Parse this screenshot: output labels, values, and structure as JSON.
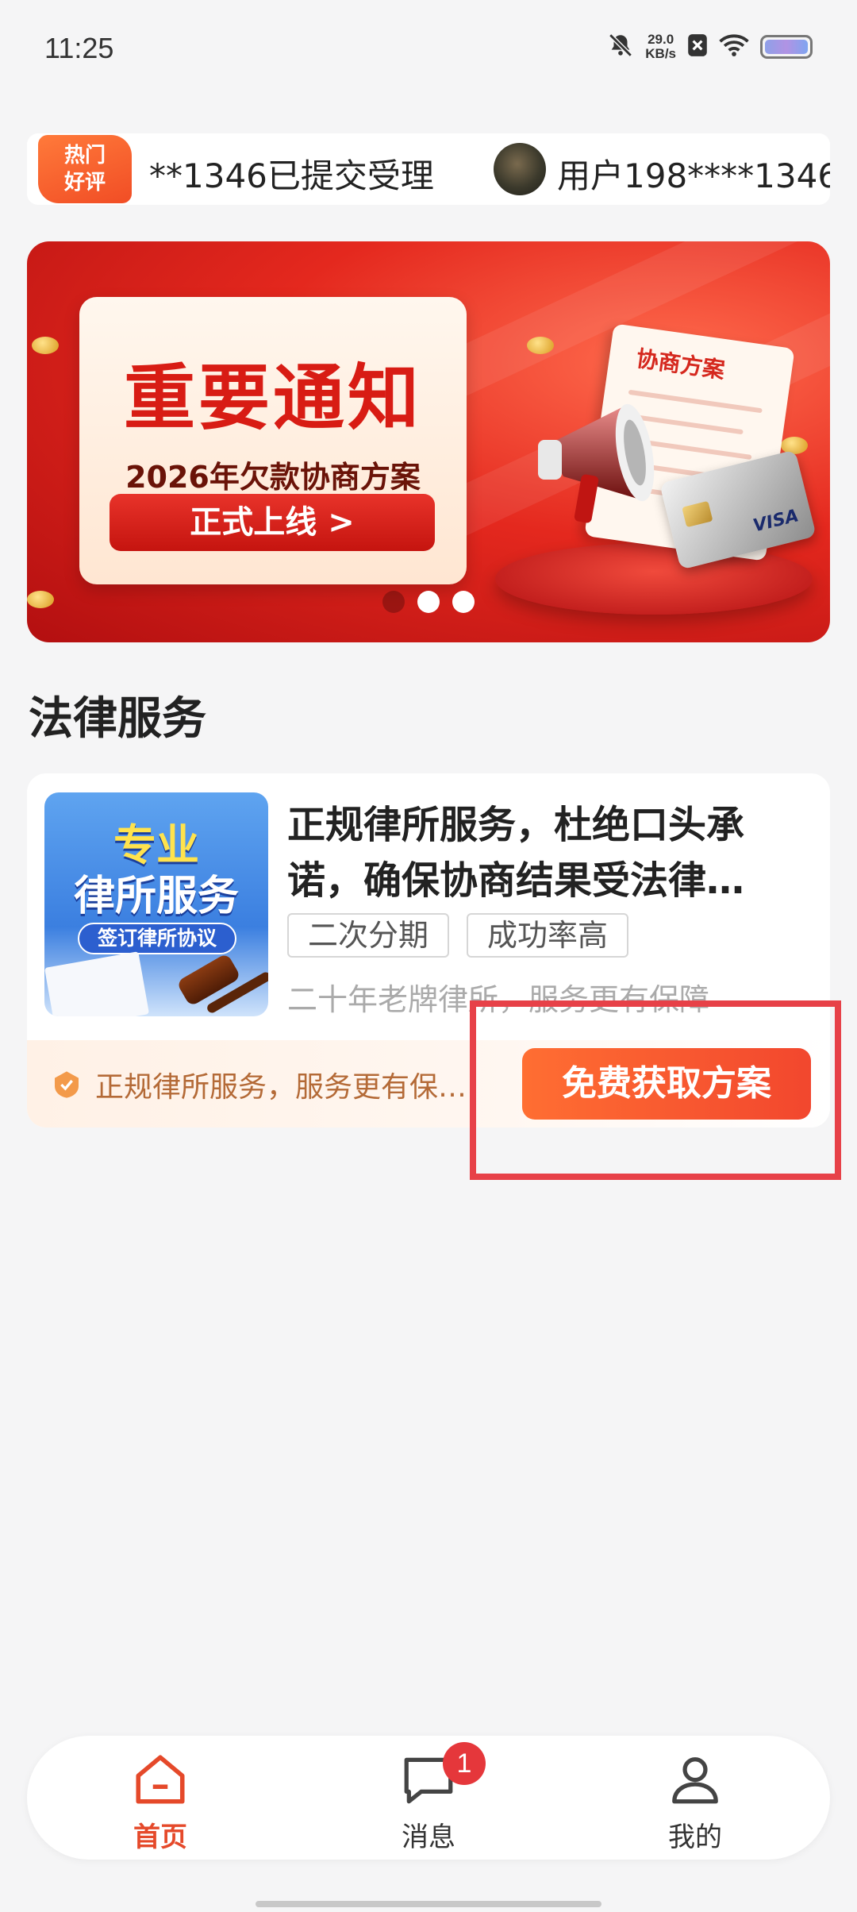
{
  "status_bar": {
    "time": "11:25",
    "net_speed_value": "29.0",
    "net_speed_unit": "KB/s",
    "icons": [
      "mute-bell-icon",
      "close-box-icon",
      "wifi-icon",
      "battery-icon"
    ]
  },
  "ticker": {
    "badge_line1": "热门",
    "badge_line2": "好评",
    "message1": "**1346已提交受理",
    "message2": "用户198****1346"
  },
  "banner": {
    "title": "重要通知",
    "subtitle": "2026年欠款协商方案",
    "button_label": "正式上线 >",
    "doc_label": "协商方案",
    "card_brand": "VISA",
    "slide_count": 3,
    "active_slide": 1
  },
  "section": {
    "title": "法律服务"
  },
  "service_card": {
    "thumb_line1": "专业",
    "thumb_line2": "律所服务",
    "thumb_pill": "签订律所协议",
    "title_line1": "正规律所服务，杜绝口头承",
    "title_line2": "诺，确保协商结果受法律…",
    "tags": [
      "二次分期",
      "成功率高"
    ],
    "description": "二十年老牌律所，服务更有保障",
    "footer_text": "正规律所服务，服务更有保…",
    "cta_label": "免费获取方案"
  },
  "tab_bar": {
    "tabs": [
      {
        "label": "首页",
        "icon": "home-icon",
        "active": true
      },
      {
        "label": "消息",
        "icon": "message-icon",
        "active": false,
        "badge": "1"
      },
      {
        "label": "我的",
        "icon": "user-icon",
        "active": false
      }
    ]
  },
  "colors": {
    "accent": "#f2472e",
    "active_tab": "#e5492a",
    "highlight_frame": "#e74148",
    "badge_red": "#e5373b"
  }
}
